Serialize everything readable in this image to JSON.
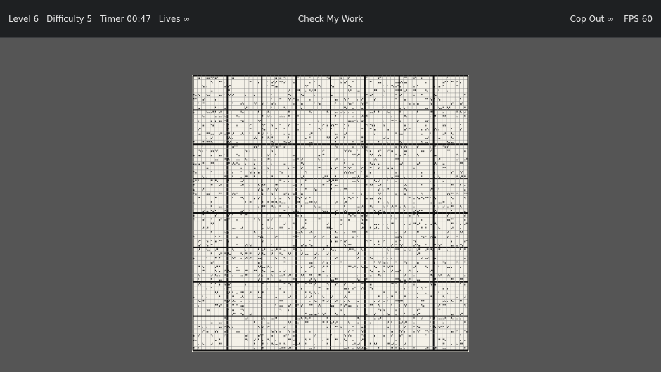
{
  "hud": {
    "level": "Level 6",
    "difficulty": "Difficulty 5",
    "timer": "Timer 00:47",
    "lives": "Lives ∞",
    "check": "Check My Work",
    "cop_out": "Cop Out ∞",
    "fps": "FPS 60"
  },
  "board": {
    "blocks_per_side": 8,
    "cells_per_block": 8,
    "colors": {
      "cell_bg": "#f4f1e8",
      "thin_line": "#8a8a8a",
      "thick_line": "#111111",
      "note_text": "#2a2a2a"
    }
  }
}
